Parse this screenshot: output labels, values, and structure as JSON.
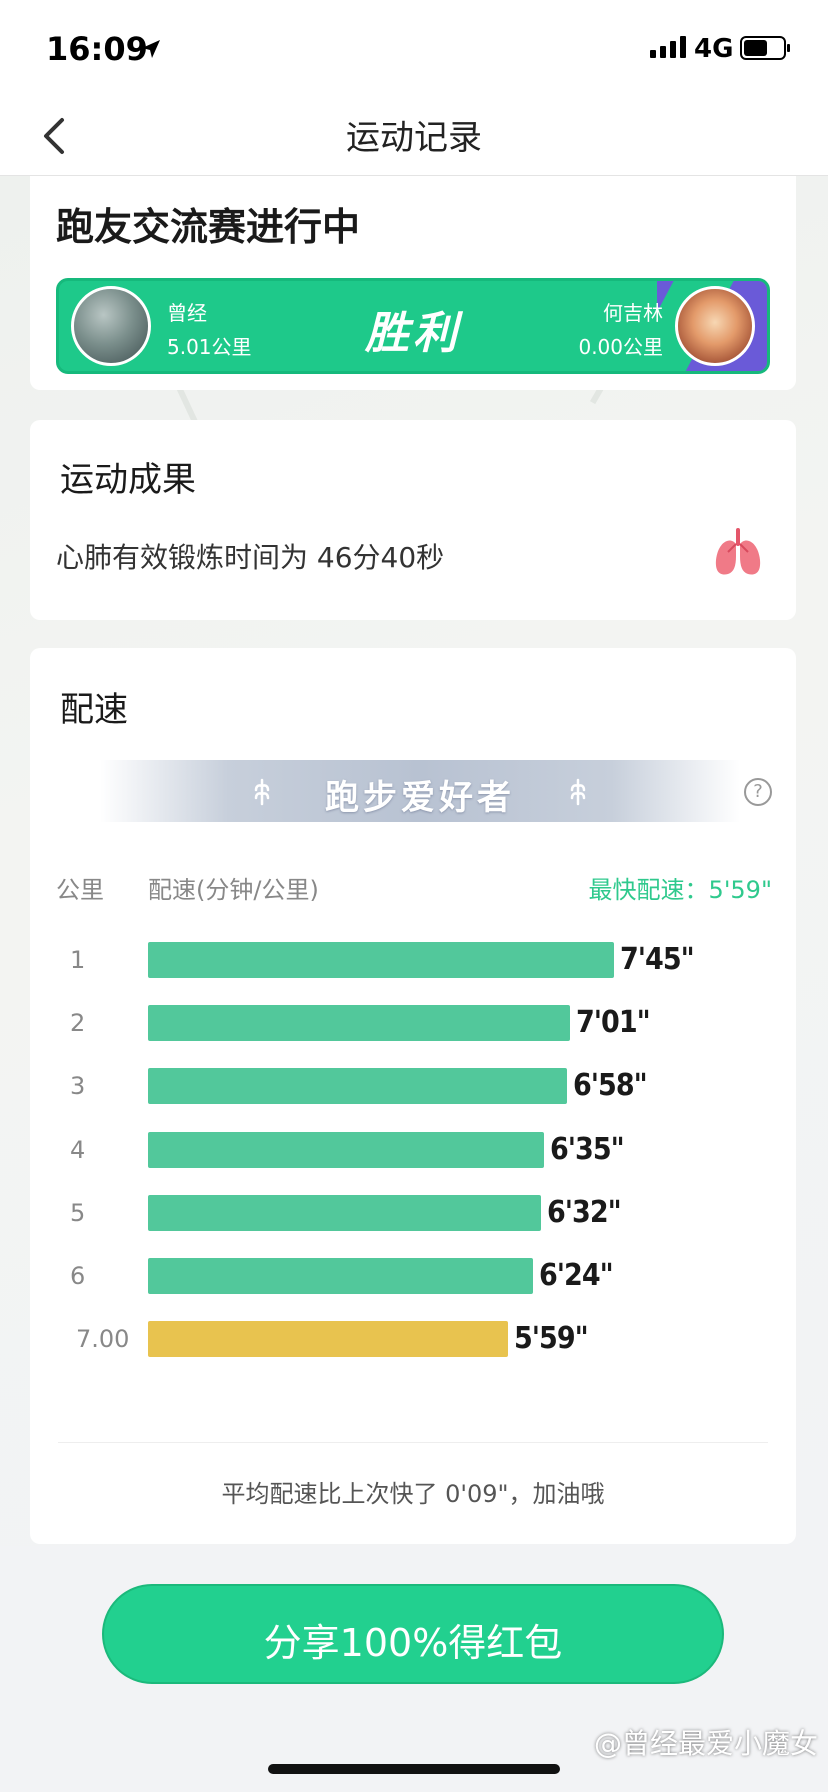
{
  "status_bar": {
    "time": "16:09",
    "network": "4G",
    "battery_level": 0.6
  },
  "nav": {
    "title": "运动记录"
  },
  "race": {
    "title": "跑友交流赛进行中",
    "result": "胜利",
    "player_left": {
      "name": "曾经",
      "distance": "5.01公里"
    },
    "player_right": {
      "name": "何吉林",
      "distance": "0.00公里"
    },
    "colors": {
      "green": "#1ec98a",
      "purple": "#6a5ad8"
    }
  },
  "achievement": {
    "title": "运动成果",
    "text": "心肺有效锻炼时间为 46分40秒",
    "icon": "lungs-icon"
  },
  "pace": {
    "title": "配速",
    "level": "跑步爱好者",
    "col_km": "公里",
    "col_pace": "配速(分钟/公里)",
    "fastest": "最快配速：5'59\"",
    "summary": "平均配速比上次快了 0'09\"，加油哦"
  },
  "chart_data": {
    "type": "bar",
    "orientation": "horizontal",
    "categories": [
      "1",
      "2",
      "3",
      "4",
      "5",
      "6",
      "7.00"
    ],
    "labels": [
      "7'45\"",
      "7'01\"",
      "6'58\"",
      "6'35\"",
      "6'32\"",
      "6'24\"",
      "5'59\""
    ],
    "values": [
      7.75,
      7.0167,
      6.9667,
      6.5833,
      6.5333,
      6.4,
      5.9833
    ],
    "highlight_index": 6,
    "colors": {
      "normal": "#52c89b",
      "highlight": "#e8c34f"
    }
  },
  "share": {
    "label": "分享100%得红包"
  },
  "watermark": "@曾经最爱小魔女"
}
